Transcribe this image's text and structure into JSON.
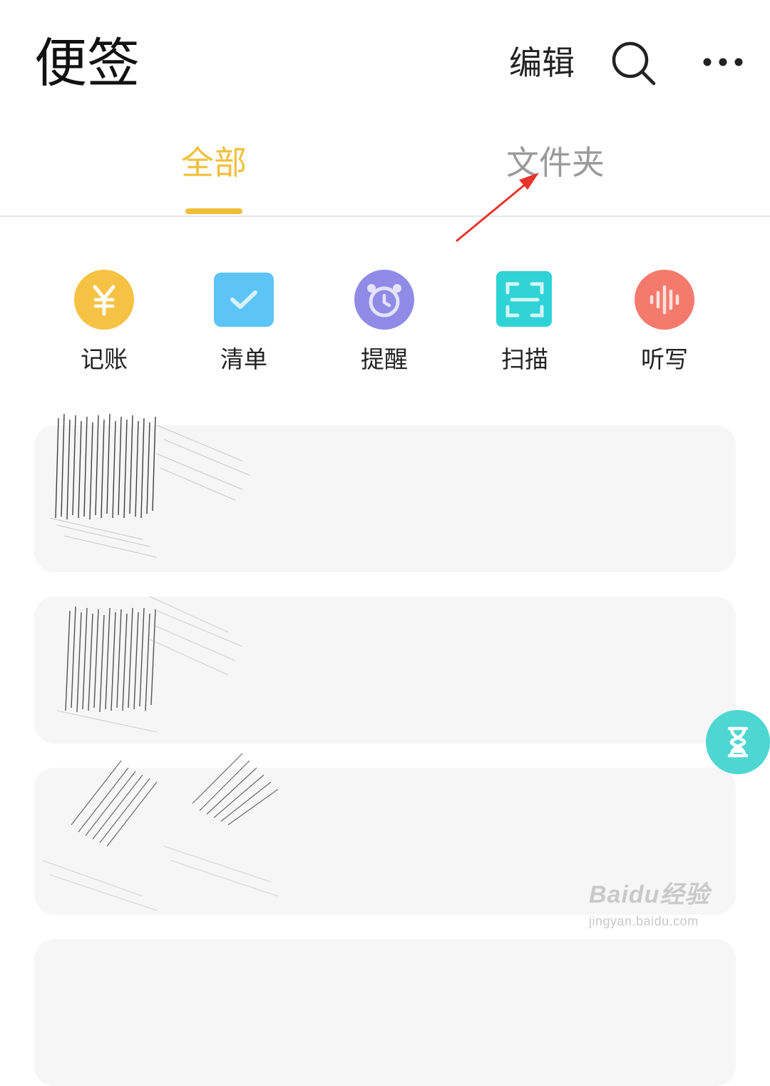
{
  "header": {
    "title": "便签",
    "edit_label": "编辑",
    "search_icon": "search-icon",
    "more_icon": "more-horizontal-icon"
  },
  "tabs": [
    {
      "label": "全部",
      "selected": true
    },
    {
      "label": "文件夹",
      "selected": false
    }
  ],
  "shortcuts": [
    {
      "label": "记账",
      "icon": "yuan-icon",
      "color": "#f5c244"
    },
    {
      "label": "清单",
      "icon": "checklist-icon",
      "color": "#5cc4f7"
    },
    {
      "label": "提醒",
      "icon": "alarm-clock-icon",
      "color": "#8f8be6"
    },
    {
      "label": "扫描",
      "icon": "scan-icon",
      "color": "#2fd3d6"
    },
    {
      "label": "听写",
      "icon": "voice-wave-icon",
      "color": "#f47a6e"
    }
  ],
  "notes_visible": 3,
  "floating_button_icon": "hourglass-icon",
  "colors": {
    "accent": "#f0bf3a",
    "inactive_tab": "#9a9a9a",
    "card_bg": "#f6f6f6",
    "annotation_arrow": "#e8342a",
    "fab": "#4dd6d2"
  },
  "watermark": {
    "logo": "Baidu经验",
    "url": "jingyan.baidu.com"
  }
}
